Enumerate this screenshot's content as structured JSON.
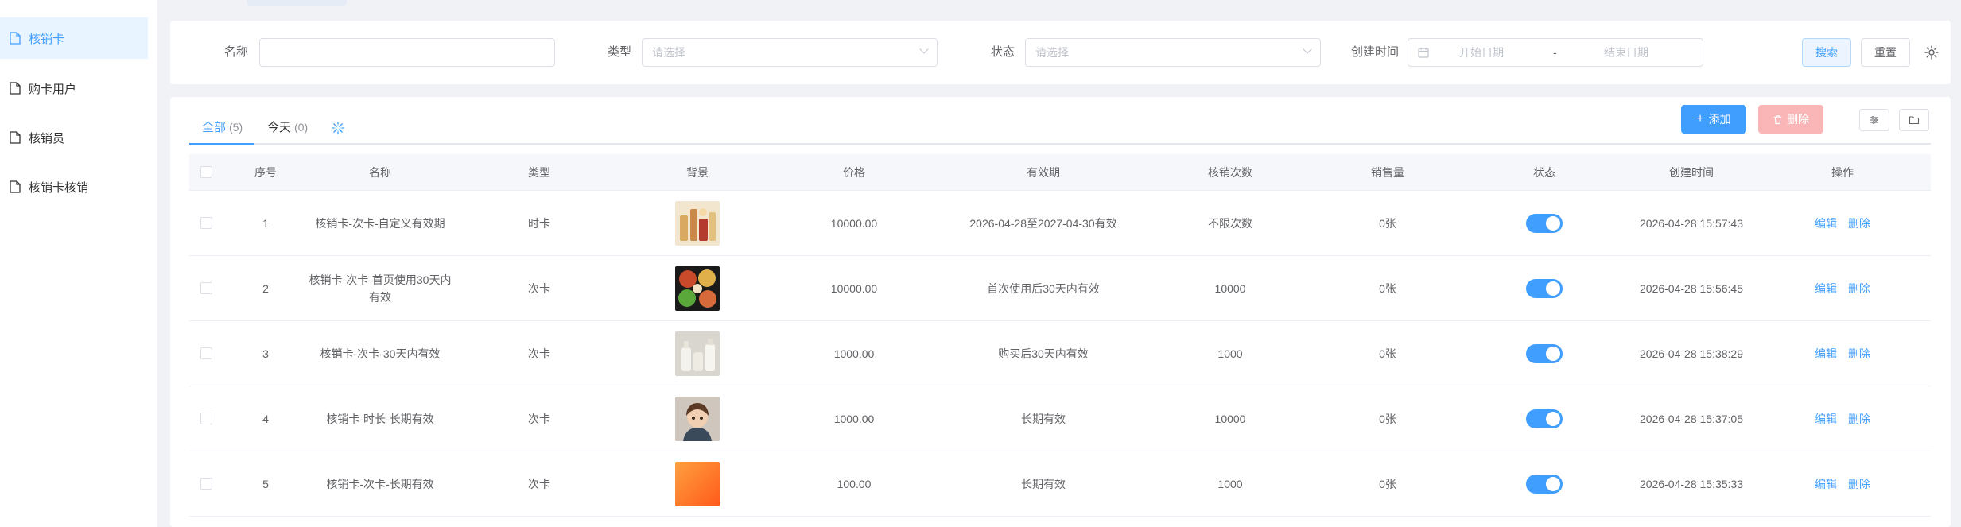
{
  "sidebar": {
    "items": [
      {
        "label": "核销卡",
        "active": true
      },
      {
        "label": "购卡用户",
        "active": false
      },
      {
        "label": "核销员",
        "active": false
      },
      {
        "label": "核销卡核销",
        "active": false
      }
    ]
  },
  "search": {
    "name_label": "名称",
    "name_value": "",
    "type_label": "类型",
    "type_placeholder": "请选择",
    "status_label": "状态",
    "status_placeholder": "请选择",
    "created_label": "创建时间",
    "start_placeholder": "开始日期",
    "range_separator": "-",
    "end_placeholder": "结束日期",
    "search_btn": "搜索",
    "reset_btn": "重置"
  },
  "tabs": [
    {
      "label": "全部",
      "count": "(5)"
    },
    {
      "label": "今天",
      "count": "(0)"
    }
  ],
  "toolbar": {
    "add_label": "添加",
    "delete_label": "删除"
  },
  "table": {
    "headers": [
      "序号",
      "名称",
      "类型",
      "背景",
      "价格",
      "有效期",
      "核销次数",
      "销售量",
      "状态",
      "创建时间",
      "操作"
    ],
    "rows": [
      {
        "no": "1",
        "name": "核销卡-次卡-自定义有效期",
        "type": "时卡",
        "bg": "cosmetics",
        "price": "10000.00",
        "validity": "2026-04-28至2027-04-30有效",
        "times": "不限次数",
        "sales": "0张",
        "status": true,
        "created": "2026-04-28 15:57:43",
        "edit": "编辑",
        "del": "删除"
      },
      {
        "no": "2",
        "name": "核销卡-次卡-首页使用30天内有效",
        "type": "次卡",
        "bg": "food",
        "price": "10000.00",
        "validity": "首次使用后30天内有效",
        "times": "10000",
        "sales": "0张",
        "status": true,
        "created": "2026-04-28 15:56:45",
        "edit": "编辑",
        "del": "删除"
      },
      {
        "no": "3",
        "name": "核销卡-次卡-30天内有效",
        "type": "次卡",
        "bg": "bottles",
        "price": "1000.00",
        "validity": "购买后30天内有效",
        "times": "1000",
        "sales": "0张",
        "status": true,
        "created": "2026-04-28 15:38:29",
        "edit": "编辑",
        "del": "删除"
      },
      {
        "no": "4",
        "name": "核销卡-时长-长期有效",
        "type": "次卡",
        "bg": "avatar",
        "price": "1000.00",
        "validity": "长期有效",
        "times": "10000",
        "sales": "0张",
        "status": true,
        "created": "2026-04-28 15:37:05",
        "edit": "编辑",
        "del": "删除"
      },
      {
        "no": "5",
        "name": "核销卡-次卡-长期有效",
        "type": "次卡",
        "bg": "orange",
        "price": "100.00",
        "validity": "长期有效",
        "times": "1000",
        "sales": "0张",
        "status": true,
        "created": "2026-04-28 15:35:33",
        "edit": "编辑",
        "del": "删除"
      }
    ]
  },
  "colors": {
    "primary": "#409eff",
    "danger_disabled": "#fab6b6",
    "sidebar_active_bg": "#e8f4ff"
  }
}
